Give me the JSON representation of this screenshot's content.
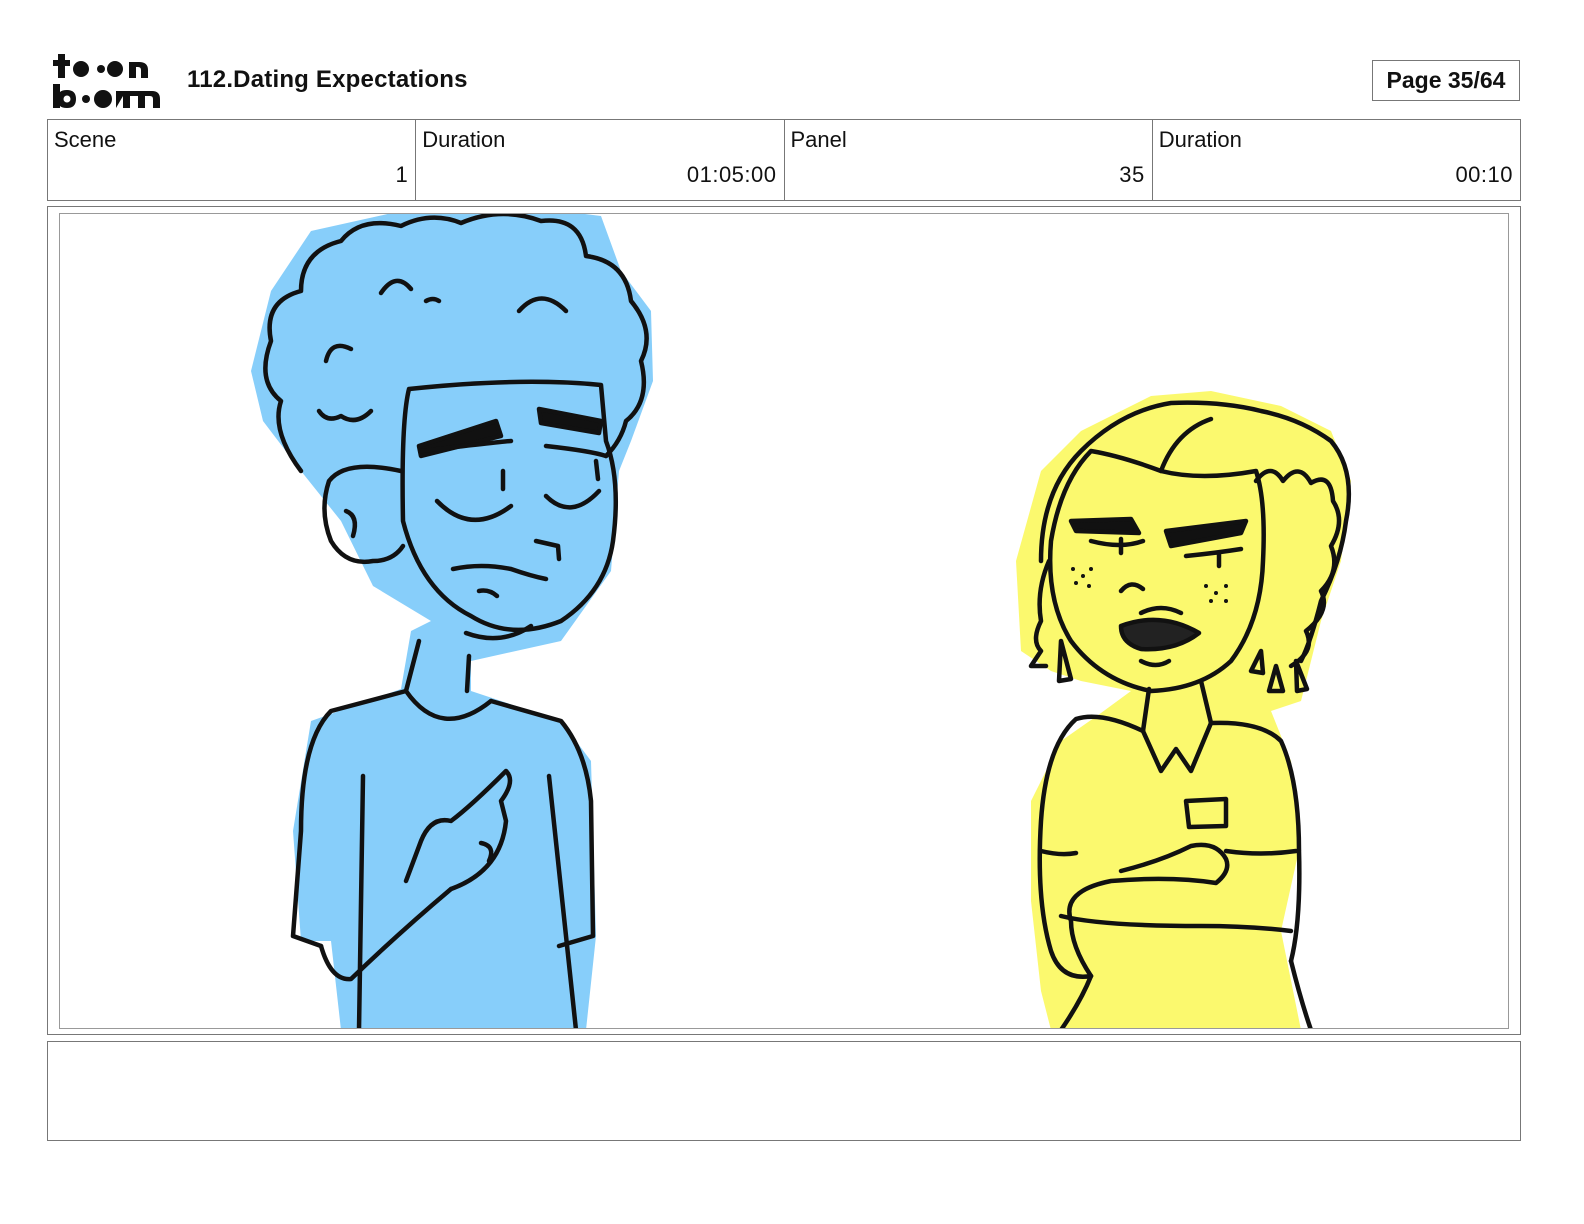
{
  "header": {
    "project_title": "112.Dating Expectations",
    "page_label": "Page 35/64",
    "logo_alt": "toon boom"
  },
  "info": {
    "scene_label": "Scene",
    "scene_value": "1",
    "scene_duration_label": "Duration",
    "scene_duration_value": "01:05:00",
    "panel_label": "Panel",
    "panel_value": "35",
    "panel_duration_label": "Duration",
    "panel_duration_value": "00:10"
  },
  "notes": {
    "text": ""
  },
  "colors": {
    "male_fill": "#87cefa",
    "female_fill": "#fbf96e",
    "line": "#111111",
    "border": "#777777"
  }
}
